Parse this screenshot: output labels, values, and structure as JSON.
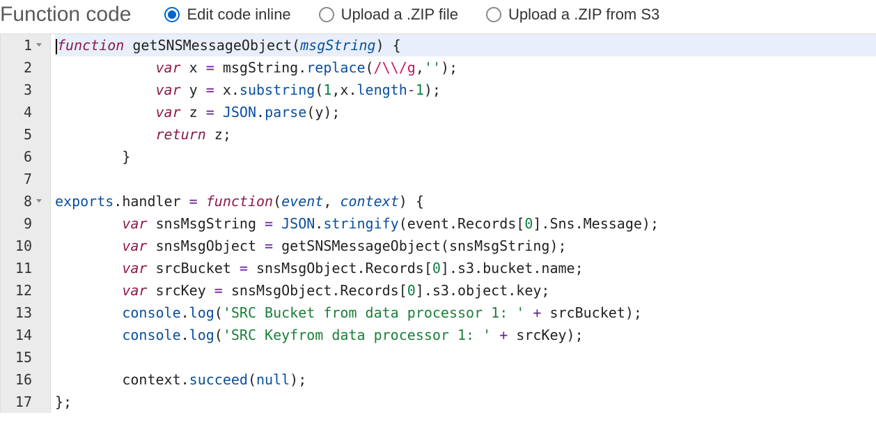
{
  "header": {
    "title": "Function code",
    "options": [
      {
        "label": "Edit code inline",
        "selected": true
      },
      {
        "label": "Upload a .ZIP file",
        "selected": false
      },
      {
        "label": "Upload a .ZIP from S3",
        "selected": false
      }
    ]
  },
  "editor": {
    "lines": [
      {
        "n": "1",
        "fold": true,
        "active": true,
        "tokens": [
          {
            "t": "function",
            "c": "kw"
          },
          {
            "t": " ",
            "c": "plain"
          },
          {
            "t": "getSNSMessageObject",
            "c": "fn"
          },
          {
            "t": "(",
            "c": "punc"
          },
          {
            "t": "msgString",
            "c": "param"
          },
          {
            "t": ")",
            "c": "punc"
          },
          {
            "t": " {",
            "c": "punc"
          }
        ]
      },
      {
        "n": "2",
        "fold": false,
        "tokens": [
          {
            "t": "            ",
            "c": "plain"
          },
          {
            "t": "var",
            "c": "kw2"
          },
          {
            "t": " x ",
            "c": "plain"
          },
          {
            "t": "=",
            "c": "op"
          },
          {
            "t": " msgString.",
            "c": "plain"
          },
          {
            "t": "replace",
            "c": "prop"
          },
          {
            "t": "(",
            "c": "punc"
          },
          {
            "t": "/\\\\/g",
            "c": "regex"
          },
          {
            "t": ",",
            "c": "punc"
          },
          {
            "t": "''",
            "c": "str"
          },
          {
            "t": ");",
            "c": "punc"
          }
        ]
      },
      {
        "n": "3",
        "fold": false,
        "tokens": [
          {
            "t": "            ",
            "c": "plain"
          },
          {
            "t": "var",
            "c": "kw2"
          },
          {
            "t": " y ",
            "c": "plain"
          },
          {
            "t": "=",
            "c": "op"
          },
          {
            "t": " x.",
            "c": "plain"
          },
          {
            "t": "substring",
            "c": "prop"
          },
          {
            "t": "(",
            "c": "punc"
          },
          {
            "t": "1",
            "c": "num"
          },
          {
            "t": ",x.",
            "c": "plain"
          },
          {
            "t": "length",
            "c": "prop"
          },
          {
            "t": "-",
            "c": "op"
          },
          {
            "t": "1",
            "c": "num"
          },
          {
            "t": ");",
            "c": "punc"
          }
        ]
      },
      {
        "n": "4",
        "fold": false,
        "tokens": [
          {
            "t": "            ",
            "c": "plain"
          },
          {
            "t": "var",
            "c": "kw2"
          },
          {
            "t": " z ",
            "c": "plain"
          },
          {
            "t": "=",
            "c": "op"
          },
          {
            "t": " ",
            "c": "plain"
          },
          {
            "t": "JSON",
            "c": "obj"
          },
          {
            "t": ".",
            "c": "plain"
          },
          {
            "t": "parse",
            "c": "prop"
          },
          {
            "t": "(y);",
            "c": "punc"
          }
        ]
      },
      {
        "n": "5",
        "fold": false,
        "tokens": [
          {
            "t": "            ",
            "c": "plain"
          },
          {
            "t": "return",
            "c": "kw2"
          },
          {
            "t": " z;",
            "c": "plain"
          }
        ]
      },
      {
        "n": "6",
        "fold": false,
        "tokens": [
          {
            "t": "        }",
            "c": "punc"
          }
        ]
      },
      {
        "n": "7",
        "fold": false,
        "tokens": []
      },
      {
        "n": "8",
        "fold": true,
        "tokens": [
          {
            "t": "exports",
            "c": "obj"
          },
          {
            "t": ".handler ",
            "c": "plain"
          },
          {
            "t": "=",
            "c": "op"
          },
          {
            "t": " ",
            "c": "plain"
          },
          {
            "t": "function",
            "c": "kw"
          },
          {
            "t": "(",
            "c": "punc"
          },
          {
            "t": "event",
            "c": "param"
          },
          {
            "t": ", ",
            "c": "punc"
          },
          {
            "t": "context",
            "c": "param"
          },
          {
            "t": ")",
            "c": "punc"
          },
          {
            "t": " {",
            "c": "punc"
          }
        ]
      },
      {
        "n": "9",
        "fold": false,
        "tokens": [
          {
            "t": "        ",
            "c": "plain"
          },
          {
            "t": "var",
            "c": "kw2"
          },
          {
            "t": " snsMsgString ",
            "c": "plain"
          },
          {
            "t": "=",
            "c": "op"
          },
          {
            "t": " ",
            "c": "plain"
          },
          {
            "t": "JSON",
            "c": "obj"
          },
          {
            "t": ".",
            "c": "plain"
          },
          {
            "t": "stringify",
            "c": "prop"
          },
          {
            "t": "(event.Records[",
            "c": "plain"
          },
          {
            "t": "0",
            "c": "num"
          },
          {
            "t": "].Sns.Message);",
            "c": "plain"
          }
        ]
      },
      {
        "n": "10",
        "fold": false,
        "tokens": [
          {
            "t": "        ",
            "c": "plain"
          },
          {
            "t": "var",
            "c": "kw2"
          },
          {
            "t": " snsMsgObject ",
            "c": "plain"
          },
          {
            "t": "=",
            "c": "op"
          },
          {
            "t": " getSNSMessageObject(snsMsgString);",
            "c": "plain"
          }
        ]
      },
      {
        "n": "11",
        "fold": false,
        "tokens": [
          {
            "t": "        ",
            "c": "plain"
          },
          {
            "t": "var",
            "c": "kw2"
          },
          {
            "t": " srcBucket ",
            "c": "plain"
          },
          {
            "t": "=",
            "c": "op"
          },
          {
            "t": " snsMsgObject.Records[",
            "c": "plain"
          },
          {
            "t": "0",
            "c": "num"
          },
          {
            "t": "].s3.bucket.name;",
            "c": "plain"
          }
        ]
      },
      {
        "n": "12",
        "fold": false,
        "tokens": [
          {
            "t": "        ",
            "c": "plain"
          },
          {
            "t": "var",
            "c": "kw2"
          },
          {
            "t": " srcKey ",
            "c": "plain"
          },
          {
            "t": "=",
            "c": "op"
          },
          {
            "t": " snsMsgObject.Records[",
            "c": "plain"
          },
          {
            "t": "0",
            "c": "num"
          },
          {
            "t": "].s3.object.key;",
            "c": "plain"
          }
        ]
      },
      {
        "n": "13",
        "fold": false,
        "tokens": [
          {
            "t": "        ",
            "c": "plain"
          },
          {
            "t": "console",
            "c": "obj"
          },
          {
            "t": ".",
            "c": "plain"
          },
          {
            "t": "log",
            "c": "prop"
          },
          {
            "t": "(",
            "c": "punc"
          },
          {
            "t": "'SRC Bucket from data processor 1: '",
            "c": "str"
          },
          {
            "t": " ",
            "c": "plain"
          },
          {
            "t": "+",
            "c": "op"
          },
          {
            "t": " srcBucket);",
            "c": "plain"
          }
        ]
      },
      {
        "n": "14",
        "fold": false,
        "tokens": [
          {
            "t": "        ",
            "c": "plain"
          },
          {
            "t": "console",
            "c": "obj"
          },
          {
            "t": ".",
            "c": "plain"
          },
          {
            "t": "log",
            "c": "prop"
          },
          {
            "t": "(",
            "c": "punc"
          },
          {
            "t": "'SRC Keyfrom data processor 1: '",
            "c": "str"
          },
          {
            "t": " ",
            "c": "plain"
          },
          {
            "t": "+",
            "c": "op"
          },
          {
            "t": " srcKey);",
            "c": "plain"
          }
        ]
      },
      {
        "n": "15",
        "fold": false,
        "tokens": []
      },
      {
        "n": "16",
        "fold": false,
        "tokens": [
          {
            "t": "        context.",
            "c": "plain"
          },
          {
            "t": "succeed",
            "c": "prop"
          },
          {
            "t": "(",
            "c": "punc"
          },
          {
            "t": "null",
            "c": "obj"
          },
          {
            "t": ");",
            "c": "punc"
          }
        ]
      },
      {
        "n": "17",
        "fold": false,
        "tokens": [
          {
            "t": "};",
            "c": "punc"
          }
        ]
      }
    ]
  }
}
